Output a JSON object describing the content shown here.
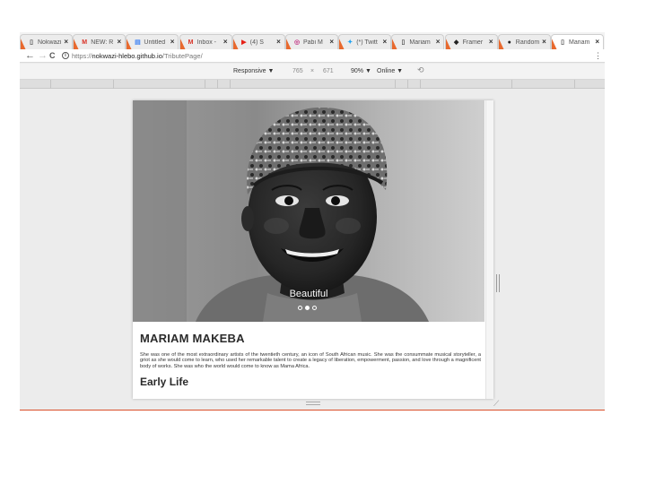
{
  "tabs": [
    {
      "label": "Nokwazi",
      "icon": "page-icon",
      "color": "#555555"
    },
    {
      "label": "NEW: R",
      "icon": "gmail-icon",
      "color": "#d93025"
    },
    {
      "label": "Untitled",
      "icon": "forms-icon",
      "color": "#4285f4"
    },
    {
      "label": "Inbox -",
      "icon": "gmail-icon",
      "color": "#d93025"
    },
    {
      "label": "(4) S",
      "icon": "youtube-icon",
      "color": "#e62117"
    },
    {
      "label": "Pabi M",
      "icon": "instagram-icon",
      "color": "#c13584"
    },
    {
      "label": "(*) Twitt",
      "icon": "twitter-icon",
      "color": "#1da1f2"
    },
    {
      "label": "Mariam",
      "icon": "page-icon",
      "color": "#555555"
    },
    {
      "label": "Framer",
      "icon": "framer-icon",
      "color": "#222222"
    },
    {
      "label": "Random",
      "icon": "random-icon",
      "color": "#222222"
    },
    {
      "label": "Mariam",
      "icon": "page-icon",
      "color": "#555555",
      "active": true
    }
  ],
  "tab_close_glyph": "×",
  "toolbar": {
    "back": "←",
    "forward": "→",
    "reload": "C",
    "info": "i",
    "url_prefix": "https://",
    "url_host": "nokwazi-hlebo.github.io",
    "url_path": "/TributePage/",
    "menu": "⋮"
  },
  "devtools": {
    "device": "Responsive ▼",
    "width": "765",
    "times": "×",
    "height": "671",
    "zoom": "90% ▼",
    "network": "Online ▼",
    "rotate": "⟲"
  },
  "page": {
    "caption": "Beautiful",
    "title": "MARIAM MAKEBA",
    "bio": "She was one of the most extraordinary artists of the twentieth century, an icon of South African music. She was the consummate musical storyteller, a griot as she would come to learn, who used her remarkable talent to create a legacy of liberation, empowerment, passion, and love through a magnificent body of works. She was who the world would come to know as Mama Africa.",
    "section_title": "Early Life",
    "carousel_count": 3,
    "carousel_active": 2
  },
  "colors": {
    "tab_accent": "#e8692e",
    "page_bg": "#ececec",
    "bottom_line": "#d94f2a"
  }
}
